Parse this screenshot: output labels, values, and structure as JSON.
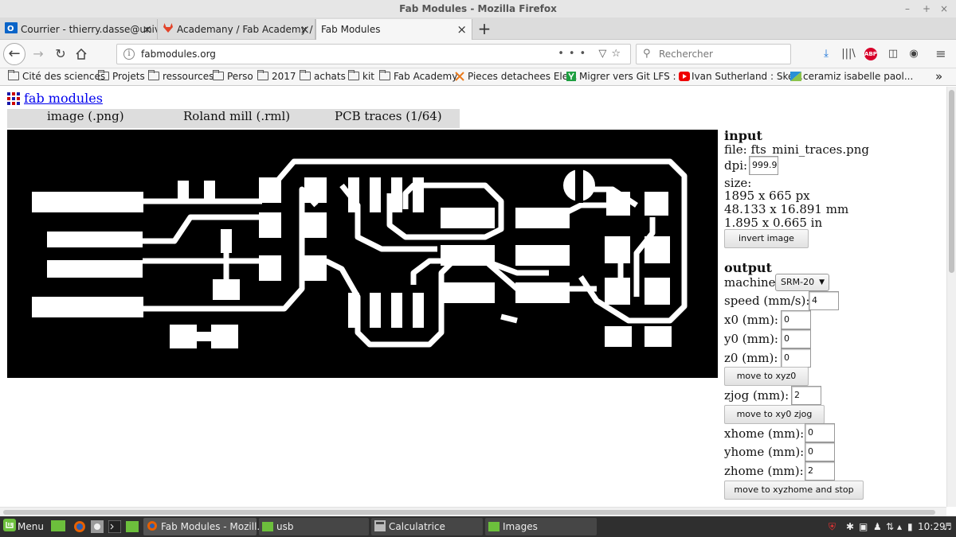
{
  "window": {
    "title": "Fab Modules - Mozilla Firefox",
    "controls": [
      "–",
      "+",
      "×"
    ]
  },
  "tabs": [
    {
      "label": "Courrier - thierry.dasse@univ",
      "icon": "outlook-icon",
      "active": false
    },
    {
      "label": "Academany / Fab Academy /",
      "icon": "gitlab-icon",
      "active": false
    },
    {
      "label": "Fab Modules",
      "icon": "",
      "active": true
    }
  ],
  "tab_close": "×",
  "new_tab": "+",
  "nav": {
    "url": "fabmodules.org",
    "search_placeholder": "Rechercher",
    "page_actions": "••• ",
    "abp_label": "ABP"
  },
  "bookmarks": [
    {
      "label": "Cité des sciences",
      "icon": "folder-icon"
    },
    {
      "label": "Projets",
      "icon": "folder-icon"
    },
    {
      "label": "ressources",
      "icon": "folder-icon"
    },
    {
      "label": "Perso",
      "icon": "folder-icon"
    },
    {
      "label": "2017",
      "icon": "folder-icon"
    },
    {
      "label": "achats",
      "icon": "folder-icon"
    },
    {
      "label": "kit",
      "icon": "folder-icon"
    },
    {
      "label": "Fab Academy",
      "icon": "folder-icon"
    },
    {
      "label": "Pieces detachees Ele...",
      "icon": "tools-icon"
    },
    {
      "label": "Migrer vers Git LFS : ...",
      "icon": "y-icon"
    },
    {
      "label": "Ivan Sutherland : Ske...",
      "icon": "youtube-icon"
    },
    {
      "label": "ceramiz isabelle paol...",
      "icon": "ceramic-icon"
    }
  ],
  "bookmarks_overflow": "»",
  "page": {
    "logo_link": "fab modules",
    "menu": [
      "image (.png)",
      "Roland mill (.rml)",
      "PCB traces (1/64)"
    ]
  },
  "panel": {
    "input_heading": "input",
    "file_label": "file: fts_mini_traces.png",
    "dpi_label": "dpi:",
    "dpi_value": "999.9",
    "size_label": "size:",
    "size_px": "1895 x 665 px",
    "size_mm": "48.133 x 16.891 mm",
    "size_in": "1.895 x 0.665 in",
    "invert_button": "invert image",
    "output_heading": "output",
    "machine_label": "machine",
    "machine_value": "SRM-20",
    "speed_label": "speed (mm/s):",
    "speed_value": "4",
    "x0_label": "x0 (mm):",
    "x0_value": "0",
    "y0_label": "y0 (mm):",
    "y0_value": "0",
    "z0_label": "z0 (mm):",
    "z0_value": "0",
    "move_xyz0_button": "move to xyz0",
    "zjog_label": "zjog (mm):",
    "zjog_value": "2",
    "move_xy0_button": "move to xy0 zjog",
    "xhome_label": "xhome (mm):",
    "xhome_value": "0",
    "yhome_label": "yhome (mm):",
    "yhome_value": "0",
    "zhome_label": "zhome (mm):",
    "zhome_value": "2",
    "move_home_button": "move to xyzhome and stop"
  },
  "taskbar": {
    "menu_label": "Menu",
    "windows": [
      "Fab Modules - Mozill...",
      "usb",
      "Calculatrice",
      "Images"
    ],
    "clock": "10:29"
  },
  "colors": {
    "pcb_background": "#000000",
    "pcb_traces": "#ffffff",
    "link": "#0000ee",
    "taskbar": "#2f2f2f"
  }
}
